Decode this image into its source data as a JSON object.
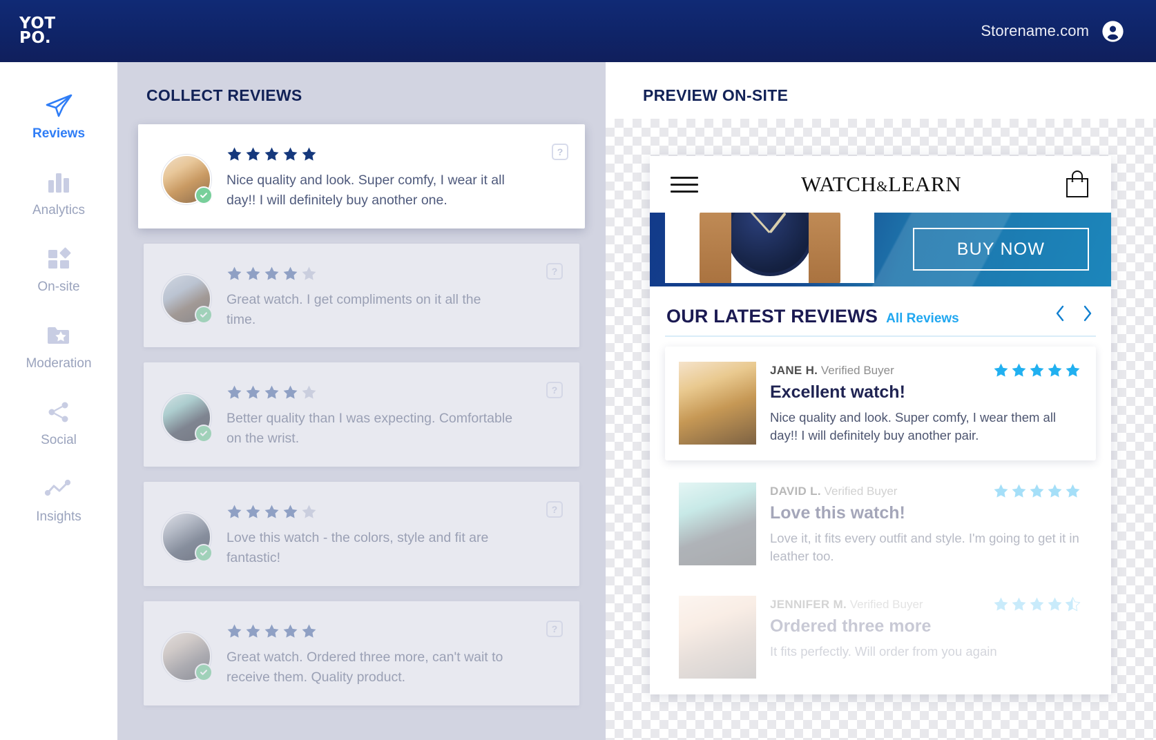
{
  "topbar": {
    "logo_line1": "YOT",
    "logo_line2": "PO.",
    "store_name": "Storename.com",
    "avatar_icon": "user-avatar-icon"
  },
  "sidebar": {
    "items": [
      {
        "label": "Reviews",
        "icon": "paper-plane-icon",
        "active": true
      },
      {
        "label": "Analytics",
        "icon": "bar-chart-icon",
        "active": false
      },
      {
        "label": "On-site",
        "icon": "shapes-icon",
        "active": false
      },
      {
        "label": "Moderation",
        "icon": "folder-star-icon",
        "active": false
      },
      {
        "label": "Social",
        "icon": "share-icon",
        "active": false
      },
      {
        "label": "Insights",
        "icon": "trend-line-icon",
        "active": false
      }
    ]
  },
  "collect": {
    "title": "COLLECT REVIEWS",
    "help_glyph": "?",
    "reviews": [
      {
        "rating": 5,
        "text": "Nice quality and look. Super comfy, I wear it all day!! I will definitely buy another one."
      },
      {
        "rating": 4,
        "text": "Great watch. I get compliments on it all the time."
      },
      {
        "rating": 4,
        "text": "Better quality than I was expecting. Comfortable on the wrist."
      },
      {
        "rating": 4,
        "text": "Love this watch - the colors, style and fit are fantastic!"
      },
      {
        "rating": 5,
        "text": "Great watch. Ordered three more, can't wait to receive them. Quality product."
      }
    ]
  },
  "preview": {
    "title": "PREVIEW ON-SITE",
    "site": {
      "menu_icon": "hamburger-menu-icon",
      "logo_left": "WATCH",
      "logo_amp": "&",
      "logo_right": "LEARN",
      "cart_icon": "shopping-bag-icon",
      "hero": {
        "buy_button": "BUY NOW",
        "product_image": "wristwatch-photo"
      }
    },
    "widget": {
      "title": "OUR LATEST REVIEWS",
      "all_reviews_link": "All Reviews",
      "prev_icon": "chevron-left-icon",
      "next_icon": "chevron-right-icon",
      "reviews": [
        {
          "author": "JANE H.",
          "badge": "Verified Buyer",
          "rating": 5,
          "title": "Excellent watch!",
          "text": "Nice quality and look. Super comfy, I wear them all day!! I will definitely buy another pair."
        },
        {
          "author": "DAVID L.",
          "badge": "Verified Buyer",
          "rating": 5,
          "title": "Love this watch!",
          "text": "Love it, it fits every outfit and style. I'm going to get it in leather too."
        },
        {
          "author": "JENNIFER M.",
          "badge": "Verified Buyer",
          "rating": 4.5,
          "title": "Ordered three more",
          "text": "It fits perfectly. Will order from you again"
        }
      ]
    }
  },
  "colors": {
    "brand_navy": "#102a75",
    "accent_blue": "#2f7df6",
    "panel_bg": "#d2d4e1",
    "star_dark": "#2d4a82",
    "star_empty": "#c5cadd",
    "widget_star": "#21b0f0",
    "verified_green": "#78cf9a",
    "link_blue": "#20a7f0"
  }
}
